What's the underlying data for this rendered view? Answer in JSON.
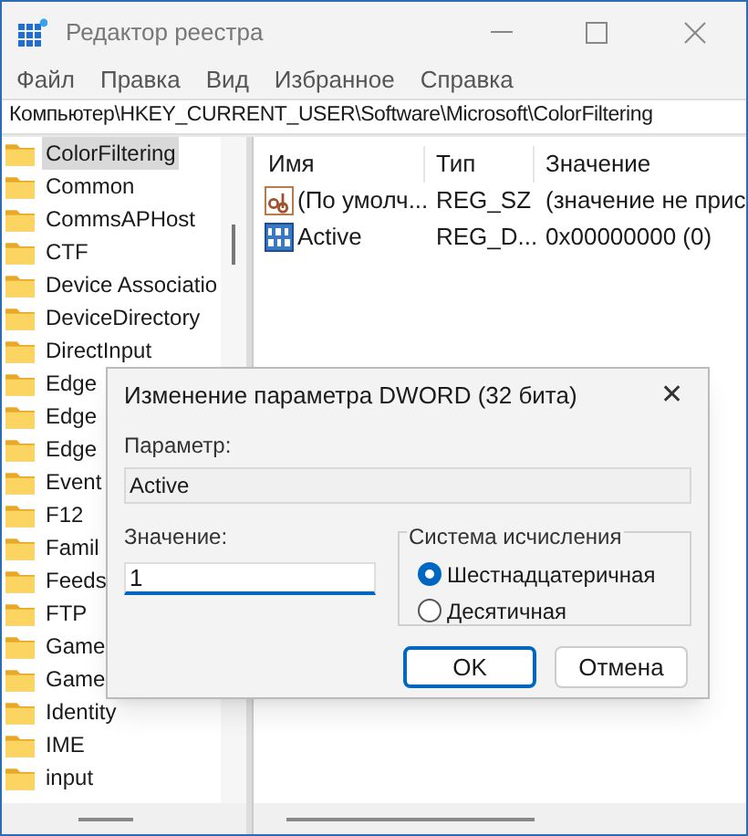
{
  "window": {
    "title": "Редактор реестра"
  },
  "menu": [
    "Файл",
    "Правка",
    "Вид",
    "Избранное",
    "Справка"
  ],
  "address": "Компьютер\\HKEY_CURRENT_USER\\Software\\Microsoft\\ColorFiltering",
  "tree": [
    {
      "label": "ColorFiltering",
      "selected": true
    },
    {
      "label": "Common",
      "selected": false
    },
    {
      "label": "CommsAPHost",
      "selected": false
    },
    {
      "label": "CTF",
      "selected": false
    },
    {
      "label": "Device Associatio",
      "selected": false
    },
    {
      "label": "DeviceDirectory",
      "selected": false
    },
    {
      "label": "DirectInput",
      "selected": false
    },
    {
      "label": "Edge",
      "selected": false
    },
    {
      "label": "Edge",
      "selected": false
    },
    {
      "label": "Edge",
      "selected": false
    },
    {
      "label": "Event",
      "selected": false
    },
    {
      "label": "F12",
      "selected": false
    },
    {
      "label": "Famil",
      "selected": false
    },
    {
      "label": "Feeds",
      "selected": false
    },
    {
      "label": "FTP",
      "selected": false
    },
    {
      "label": "Game",
      "selected": false
    },
    {
      "label": "Game",
      "selected": false
    },
    {
      "label": "Identity",
      "selected": false
    },
    {
      "label": "IME",
      "selected": false
    },
    {
      "label": "input",
      "selected": false
    }
  ],
  "values": {
    "columns": [
      "Имя",
      "Тип",
      "Значение"
    ],
    "rows": [
      {
        "kind": "string",
        "name": "(По умолч...",
        "type": "REG_SZ",
        "data": "(значение не прис"
      },
      {
        "kind": "dword",
        "name": "Active",
        "type": "REG_D...",
        "data": "0x00000000 (0)"
      }
    ]
  },
  "dialog": {
    "title": "Изменение параметра DWORD (32 бита)",
    "close": "✕",
    "name_label": "Параметр:",
    "name_value": "Active",
    "value_label": "Значение:",
    "value": "1",
    "base_group": "Система исчисления",
    "bases": [
      {
        "label": "Шестнадцатеричная",
        "selected": true
      },
      {
        "label": "Десятичная",
        "selected": false
      }
    ],
    "buttons": [
      {
        "label": "OK",
        "default": true
      },
      {
        "label": "Отмена",
        "default": false
      }
    ]
  }
}
